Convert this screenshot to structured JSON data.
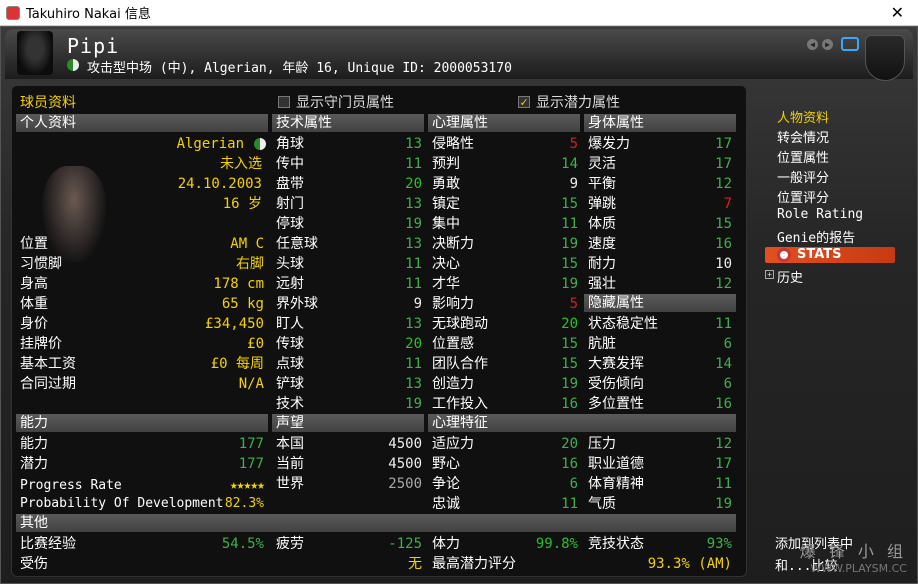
{
  "window": {
    "title": "Takuhiro Nakai 信息",
    "close": "✕"
  },
  "header": {
    "name": "Pipi",
    "subtitle": "攻击型中场 (中), Algerian, 年龄 16, Unique ID: 2000053170"
  },
  "panel": {
    "title": "球员资料",
    "gk_toggle": "显示守门员属性",
    "potential_toggle": "显示潜力属性",
    "potential_check": "✓"
  },
  "personal": {
    "header": "个人资料",
    "nationality": "Algerian",
    "status": "未入选",
    "dob": "24.10.2003",
    "age": "16 岁",
    "rows": [
      {
        "label": "位置",
        "value": "AM C"
      },
      {
        "label": "习惯脚",
        "value": "右脚"
      },
      {
        "label": "身高",
        "value": "178 cm"
      },
      {
        "label": "体重",
        "value": "65 kg"
      },
      {
        "label": "身价",
        "value": "£34,450"
      },
      {
        "label": "挂牌价",
        "value": "£0"
      },
      {
        "label": "基本工资",
        "value": "£0 每周"
      },
      {
        "label": "合同过期",
        "value": "N/A"
      }
    ]
  },
  "technical": {
    "header": "技术属性",
    "rows": [
      {
        "label": "角球",
        "value": "13"
      },
      {
        "label": "传中",
        "value": "11"
      },
      {
        "label": "盘带",
        "value": "20"
      },
      {
        "label": "射门",
        "value": "13"
      },
      {
        "label": "停球",
        "value": "19"
      },
      {
        "label": "任意球",
        "value": "13"
      },
      {
        "label": "头球",
        "value": "11"
      },
      {
        "label": "远射",
        "value": "11"
      },
      {
        "label": "界外球",
        "value": "9"
      },
      {
        "label": "盯人",
        "value": "13"
      },
      {
        "label": "传球",
        "value": "20"
      },
      {
        "label": "点球",
        "value": "11"
      },
      {
        "label": "铲球",
        "value": "13"
      },
      {
        "label": "技术",
        "value": "19"
      }
    ]
  },
  "mental": {
    "header": "心理属性",
    "rows": [
      {
        "label": "侵略性",
        "value": "5"
      },
      {
        "label": "预判",
        "value": "14"
      },
      {
        "label": "勇敢",
        "value": "9"
      },
      {
        "label": "镇定",
        "value": "15"
      },
      {
        "label": "集中",
        "value": "11"
      },
      {
        "label": "决断力",
        "value": "19"
      },
      {
        "label": "决心",
        "value": "15"
      },
      {
        "label": "才华",
        "value": "19"
      },
      {
        "label": "影响力",
        "value": "5"
      },
      {
        "label": "无球跑动",
        "value": "20"
      },
      {
        "label": "位置感",
        "value": "15"
      },
      {
        "label": "团队合作",
        "value": "15"
      },
      {
        "label": "创造力",
        "value": "19"
      },
      {
        "label": "工作投入",
        "value": "16"
      }
    ]
  },
  "physical": {
    "header": "身体属性",
    "rows": [
      {
        "label": "爆发力",
        "value": "17"
      },
      {
        "label": "灵活",
        "value": "17"
      },
      {
        "label": "平衡",
        "value": "12"
      },
      {
        "label": "弹跳",
        "value": "7"
      },
      {
        "label": "体质",
        "value": "15"
      },
      {
        "label": "速度",
        "value": "16"
      },
      {
        "label": "耐力",
        "value": "10"
      },
      {
        "label": "强壮",
        "value": "12"
      }
    ]
  },
  "hidden": {
    "header": "隐藏属性",
    "rows": [
      {
        "label": "状态稳定性",
        "value": "11"
      },
      {
        "label": "肮脏",
        "value": "6"
      },
      {
        "label": "大赛发挥",
        "value": "14"
      },
      {
        "label": "受伤倾向",
        "value": "6"
      },
      {
        "label": "多位置性",
        "value": "16"
      }
    ]
  },
  "ability": {
    "header": "能力",
    "rows": [
      {
        "label": "能力",
        "value": "177"
      },
      {
        "label": "潜力",
        "value": "177"
      }
    ],
    "progress_label": "Progress Rate",
    "progress_stars": "★★★★★",
    "prob_label": "Probability Of Development",
    "prob_value": "82.3%"
  },
  "reputation": {
    "header": "声望",
    "rows": [
      {
        "label": "本国",
        "value": "4500"
      },
      {
        "label": "当前",
        "value": "4500"
      },
      {
        "label": "世界",
        "value": "2500"
      }
    ]
  },
  "traits": {
    "header": "心理特征",
    "left": [
      {
        "label": "适应力",
        "value": "20"
      },
      {
        "label": "野心",
        "value": "16"
      },
      {
        "label": "争论",
        "value": "6"
      },
      {
        "label": "忠诚",
        "value": "11"
      }
    ],
    "right": [
      {
        "label": "压力",
        "value": "12"
      },
      {
        "label": "职业道德",
        "value": "17"
      },
      {
        "label": "体育精神",
        "value": "11"
      },
      {
        "label": "气质",
        "value": "19"
      }
    ]
  },
  "other": {
    "header": "其他",
    "experience_label": "比赛经验",
    "experience_value": "54.5%",
    "fatigue_label": "疲劳",
    "fatigue_value": "-125",
    "stamina_label": "体力",
    "stamina_value": "99.8%",
    "condition_label": "竞技状态",
    "condition_value": "93%",
    "injury_label": "受伤",
    "injury_value": "无",
    "max_potential_label": "最高潜力评分",
    "max_potential_value": "93.3% (AM)"
  },
  "nav": {
    "items": [
      "人物资料",
      "转会情况",
      "位置属性",
      "一般评分",
      "位置评分",
      "Role Rating",
      "Genie的报告"
    ],
    "stats": "STATS",
    "history": "历史",
    "add_list": "添加到列表中",
    "compare": "和...比较"
  },
  "watermark": {
    "big": "爆 锋 小 组",
    "small": "WWW.PLAYSM.CC"
  },
  "colors": {
    "accent": "#f5d100",
    "green": "#28c028",
    "red": "#e01b1b",
    "stats": "#e05020"
  }
}
